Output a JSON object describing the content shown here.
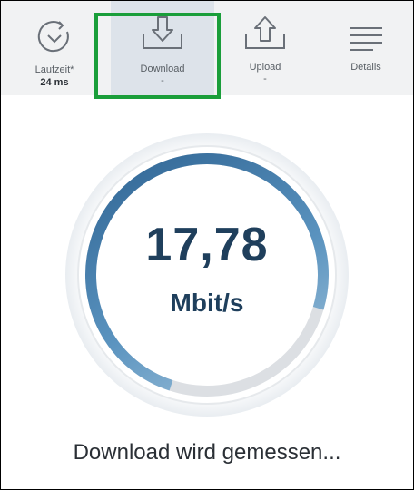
{
  "tabs": {
    "runtime": {
      "label": "Laufzeit*",
      "value": "24 ms",
      "icon": "timer-icon"
    },
    "download": {
      "label": "Download",
      "value": "-",
      "icon": "download-icon"
    },
    "upload": {
      "label": "Upload",
      "value": "-",
      "icon": "upload-icon"
    },
    "details": {
      "label": "Details",
      "icon": "menu-lines-icon"
    }
  },
  "measurement": {
    "speed_value": "17,78",
    "speed_unit": "Mbit/s",
    "status": "Download wird gemessen..."
  },
  "colors": {
    "highlight": "#1a9e3a",
    "gauge_dark": "#3d74a3",
    "gauge_light": "#bcd4e4",
    "text_dark": "#1f3f5c"
  }
}
